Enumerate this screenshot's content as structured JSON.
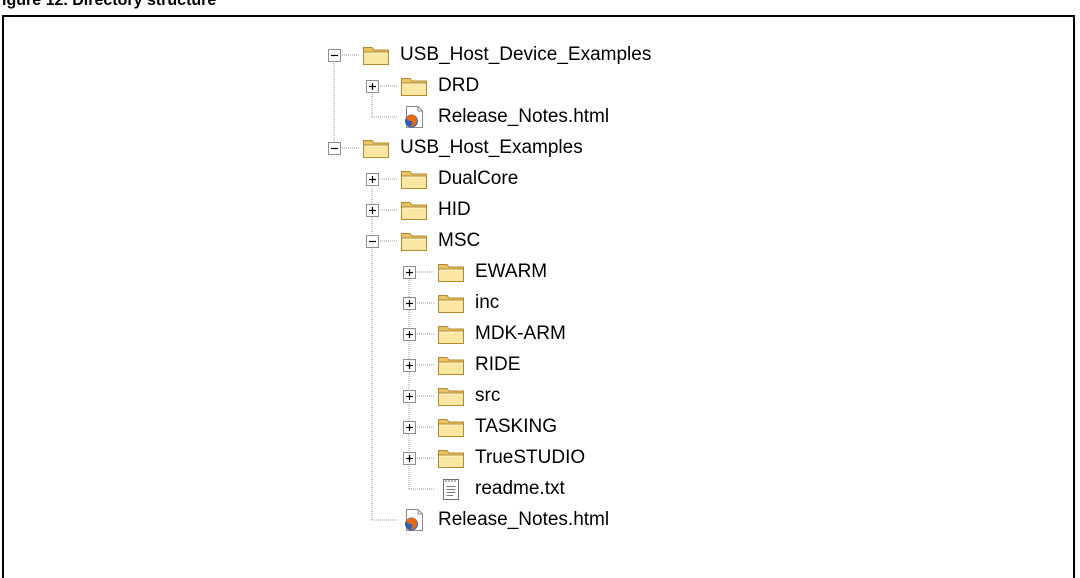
{
  "figure_caption": "igure 12. Directory structure",
  "tree": {
    "items": [
      {
        "label": "USB_Host_Device_Examples",
        "icon": "folder-icon",
        "expander": "minus"
      },
      {
        "label": "DRD",
        "icon": "folder-icon",
        "expander": "plus"
      },
      {
        "label": "Release_Notes.html",
        "icon": "html-file-icon",
        "expander": "none"
      },
      {
        "label": "USB_Host_Examples",
        "icon": "folder-icon",
        "expander": "minus"
      },
      {
        "label": "DualCore",
        "icon": "folder-icon",
        "expander": "plus"
      },
      {
        "label": "HID",
        "icon": "folder-icon",
        "expander": "plus"
      },
      {
        "label": "MSC",
        "icon": "folder-icon",
        "expander": "minus"
      },
      {
        "label": "EWARM",
        "icon": "folder-icon",
        "expander": "plus"
      },
      {
        "label": "inc",
        "icon": "folder-icon",
        "expander": "plus"
      },
      {
        "label": "MDK-ARM",
        "icon": "folder-icon",
        "expander": "plus"
      },
      {
        "label": "RIDE",
        "icon": "folder-icon",
        "expander": "plus"
      },
      {
        "label": "src",
        "icon": "folder-icon",
        "expander": "plus"
      },
      {
        "label": "TASKING",
        "icon": "folder-icon",
        "expander": "plus"
      },
      {
        "label": "TrueSTUDIO",
        "icon": "folder-icon",
        "expander": "plus"
      },
      {
        "label": "readme.txt",
        "icon": "text-file-icon",
        "expander": "none"
      },
      {
        "label": "Release_Notes.html",
        "icon": "html-file-icon",
        "expander": "none"
      }
    ]
  }
}
